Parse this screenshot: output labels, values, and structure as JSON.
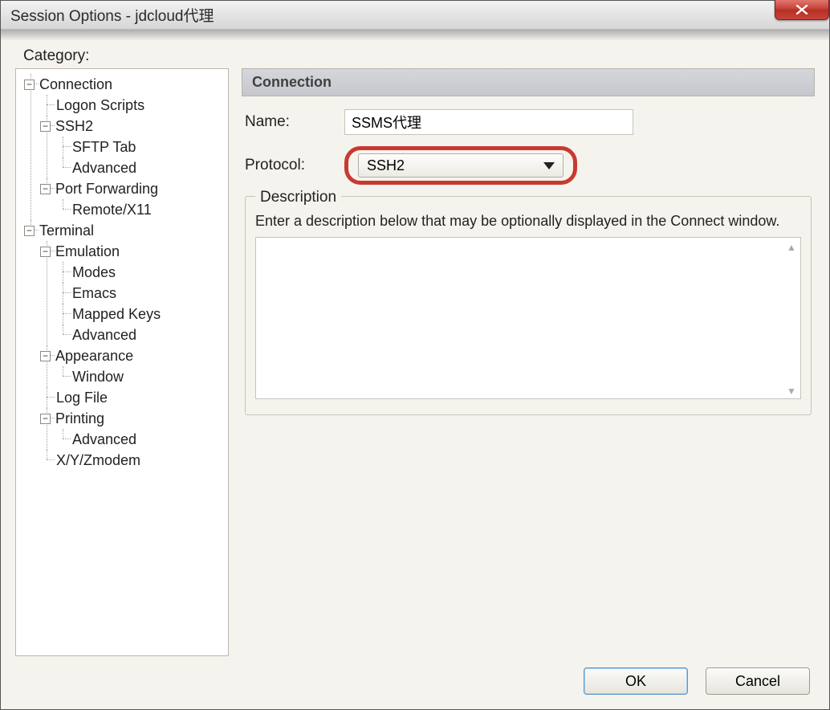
{
  "window": {
    "title": "Session Options - jdcloud代理"
  },
  "categoryLabel": "Category:",
  "tree": {
    "connection": "Connection",
    "logonScripts": "Logon Scripts",
    "ssh2": "SSH2",
    "sftpTab": "SFTP Tab",
    "ssh2Advanced": "Advanced",
    "portForwarding": "Port Forwarding",
    "remoteX11": "Remote/X11",
    "terminal": "Terminal",
    "emulation": "Emulation",
    "modes": "Modes",
    "emacs": "Emacs",
    "mappedKeys": "Mapped Keys",
    "emuAdvanced": "Advanced",
    "appearance": "Appearance",
    "windowNode": "Window",
    "logFile": "Log File",
    "printing": "Printing",
    "printAdvanced": "Advanced",
    "xyzmodem": "X/Y/Zmodem"
  },
  "panel": {
    "header": "Connection",
    "nameLabel": "Name:",
    "nameValue": "SSMS代理",
    "protocolLabel": "Protocol:",
    "protocolValue": "SSH2",
    "descLegend": "Description",
    "descHint": "Enter a description below that may be optionally displayed in the Connect window.",
    "descValue": ""
  },
  "buttons": {
    "ok": "OK",
    "cancel": "Cancel"
  }
}
